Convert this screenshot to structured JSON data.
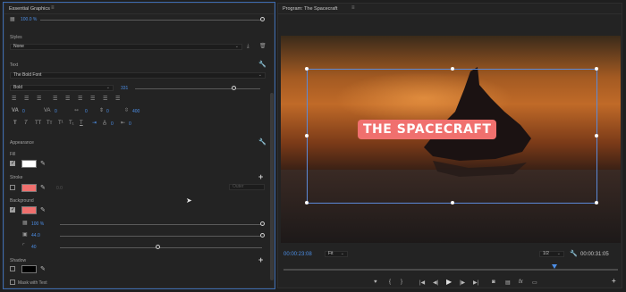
{
  "left": {
    "title": "Essential Graphics",
    "menu": "≡",
    "opacity_row": {
      "value": "100.0 %"
    },
    "styles": {
      "label": "Styles",
      "value": "None"
    },
    "text_section": {
      "label": "Text",
      "font": "The Bold Font",
      "weight": "Bold",
      "size": "331",
      "align_value": "0",
      "tracking": "0",
      "kerning": "0",
      "leading": "400",
      "baseline": "0",
      "tsume": "0",
      "tab_value": "0"
    },
    "appearance": {
      "label": "Appearance",
      "fill_label": "Fill",
      "fill_color": "#ffffff",
      "stroke_label": "Stroke",
      "stroke_color": "#f0706e",
      "stroke_value": "0.0",
      "stroke_dropdown": "Outer",
      "background_label": "Background",
      "background_color": "#f0706e",
      "bg_opacity": "100 %",
      "bg_size": "44.0",
      "bg_corner": "40",
      "shadow_label": "Shadow",
      "shadow_color": "#000000",
      "mask_label": "Mask with Text"
    }
  },
  "right": {
    "title": "Program: The Spacecraft",
    "menu": "≡",
    "title_text": "THE SPACECRAFT",
    "timecode_current": "00:00:23:08",
    "fit_label": "Fit",
    "resolution": "1/2",
    "timecode_duration": "00:00:31:05",
    "accent": "#4c8ee6"
  }
}
